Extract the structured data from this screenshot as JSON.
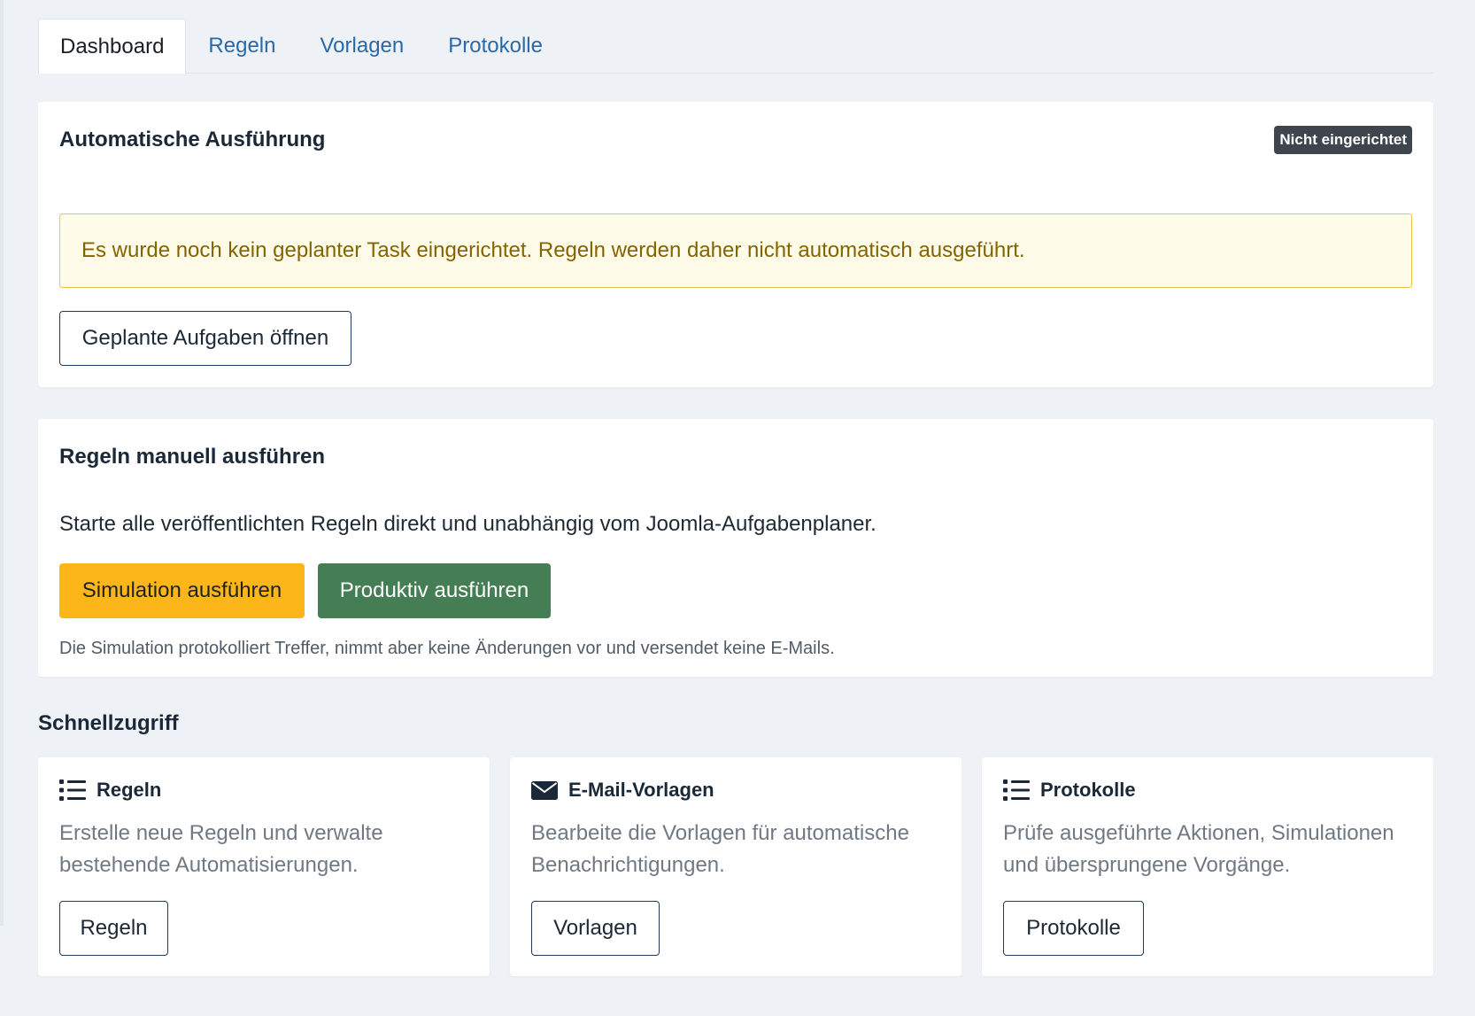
{
  "tabs": [
    "Dashboard",
    "Regeln",
    "Vorlagen",
    "Protokolle"
  ],
  "auto": {
    "title": "Automatische Ausführung",
    "badge": "Nicht eingerichtet",
    "alert": "Es wurde noch kein geplanter Task eingerichtet. Regeln werden daher nicht automatisch ausgeführt.",
    "button": "Geplante Aufgaben öffnen"
  },
  "manual": {
    "title": "Regeln manuell ausführen",
    "description": "Starte alle veröffentlichten Regeln direkt und unabhängig vom Joomla-Aufgabenplaner.",
    "simulate_button": "Simulation ausführen",
    "run_button": "Produktiv ausführen",
    "note": "Die Simulation protokolliert Treffer, nimmt aber keine Änderungen vor und versendet keine E-Mails."
  },
  "quick": {
    "heading": "Schnellzugriff",
    "cards": [
      {
        "icon": "list-icon",
        "title": "Regeln",
        "description": "Erstelle neue Regeln und verwalte bestehende Automatisierungen.",
        "button": "Regeln"
      },
      {
        "icon": "envelope-icon",
        "title": "E-Mail-Vorlagen",
        "description": "Bearbeite die Vorlagen für automatische Benachrichtigungen.",
        "button": "Vorlagen"
      },
      {
        "icon": "list-icon",
        "title": "Protokolle",
        "description": "Prüfe ausgeführte Aktionen, Simulationen und übersprungene Vorgänge.",
        "button": "Protokolle"
      }
    ]
  },
  "colors": {
    "background": "#eef2f7",
    "link": "#2a69a8",
    "badge": "#3f454c",
    "alert_bg": "#fffbe9",
    "alert_border": "#f1c34a",
    "alert_text": "#836400",
    "warning": "#fdb619",
    "success": "#457d54"
  }
}
